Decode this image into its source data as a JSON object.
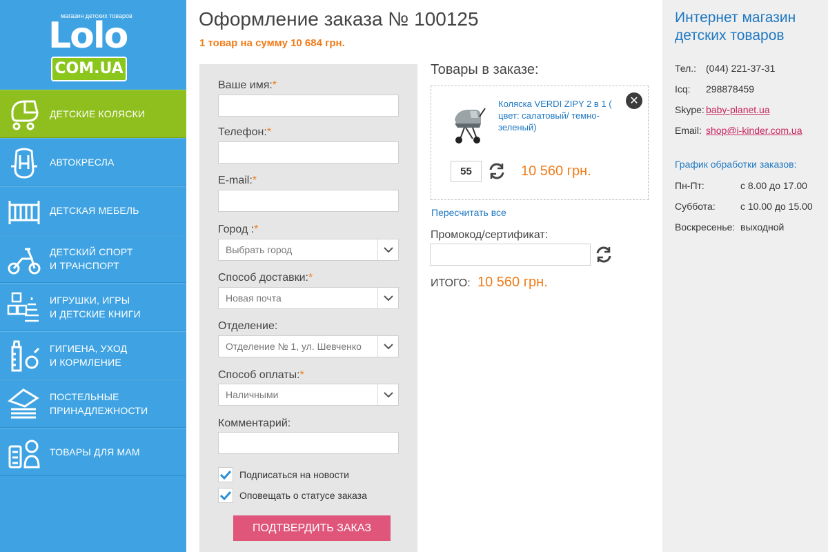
{
  "logo": {
    "tagline": "магазин детских товаров",
    "word": "Lolo",
    "domain": "COM.UA"
  },
  "colors": {
    "sidebar": "#3fa3e3",
    "active_menu": "#8fbf1e",
    "accent_orange": "#f07c1a",
    "link_blue": "#1f78c1",
    "submit_pink": "#e0567a"
  },
  "menu": [
    {
      "label": "Детские коляски",
      "icon": "stroller-icon",
      "active": true
    },
    {
      "label": "Автокресла",
      "icon": "car-seat-icon",
      "active": false
    },
    {
      "label": "Детская мебель",
      "icon": "crib-icon",
      "active": false
    },
    {
      "label_line1": "Детский спорт",
      "label_line2": "и транспорт",
      "icon": "tricycle-icon",
      "active": false
    },
    {
      "label_line1": "Игрушки, игры",
      "label_line2": "и детские книги",
      "icon": "toy-blocks-icon",
      "active": false
    },
    {
      "label_line1": "Гигиена, уход",
      "label_line2": "и кормление",
      "icon": "baby-bottle-icon",
      "active": false
    },
    {
      "label_line1": "Постельные",
      "label_line2": "принадлежности",
      "icon": "pillow-icon",
      "active": false
    },
    {
      "label": "Товары для мам",
      "icon": "baby-monitor-icon",
      "active": false
    }
  ],
  "page": {
    "title": "Оформление заказа № 100125",
    "summary": "1 товар на сумму 10 684 грн."
  },
  "form": {
    "name_label": "Ваше имя:",
    "phone_label": "Телефон:",
    "email_label": "E-mail:",
    "city_label": "Город :",
    "city_value": "Выбрать город",
    "delivery_label": "Способ доставки:",
    "delivery_value": "Новая почта",
    "branch_label": "Отделение:",
    "branch_value": "Отделение № 1, ул. Шевченко",
    "payment_label": "Способ оплаты:",
    "payment_value": "Наличными",
    "comment_label": "Комментарий:",
    "required_mark": "*",
    "subscribe_label": "Подписаться на новости",
    "subscribe_checked": true,
    "notify_label": "Оповещать о статусе заказа",
    "notify_checked": true,
    "submit_label": "Подтвердить заказ"
  },
  "cart": {
    "title": "Товары в заказе:",
    "item": {
      "name": "Коляска VERDI ZIPY 2 в 1 ( цвет: салатовый/ темно-зеленый)",
      "quantity": "55",
      "price": "10 560 грн."
    },
    "recalc_label": "Пересчитать все",
    "promo_label": "Промокод/сертификат:",
    "total_label": "Итого:",
    "total_value": "10 560 грн."
  },
  "shop": {
    "title": "Интернет магазин детских товаров",
    "contacts": [
      {
        "key": "Тел.:",
        "value": "(044) 221-37-31",
        "link": false
      },
      {
        "key": "Icq:",
        "value": "298878459",
        "link": false
      },
      {
        "key": "Skype:",
        "value": "baby-planet.ua",
        "link": true
      },
      {
        "key": "Email:",
        "value": "shop@i-kinder.com.ua",
        "link": true
      }
    ],
    "schedule_title": "График обработки заказов:",
    "schedule": [
      {
        "day": "Пн-Пт:",
        "time": "с 8.00 до 17.00"
      },
      {
        "day": "Суббота:",
        "time": "с 10.00 до 15.00"
      },
      {
        "day": "Воскресенье:",
        "time": "выходной"
      }
    ]
  }
}
